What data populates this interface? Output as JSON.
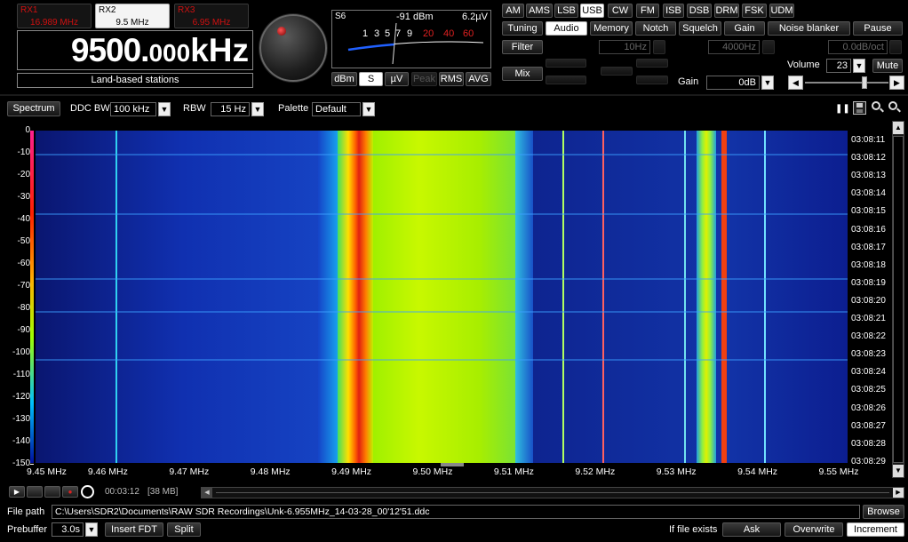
{
  "rx_tabs": [
    {
      "name": "RX1",
      "freq": "16.989 MHz",
      "active": false
    },
    {
      "name": "RX2",
      "freq": "9.5 MHz",
      "active": true
    },
    {
      "name": "RX3",
      "freq": "6.95 MHz",
      "active": false
    }
  ],
  "frequency_display": {
    "value": "9500.",
    "small": "000",
    "unit": "kHz"
  },
  "station_label": "Land-based stations",
  "smeter": {
    "s_label": "S6",
    "dbm": "-91 dBm",
    "uv": "6.2µV",
    "scale_white": [
      "1",
      "3",
      "5",
      "7",
      "9"
    ],
    "scale_red": [
      "20",
      "40",
      "60"
    ]
  },
  "meter_buttons": [
    {
      "label": "dBm",
      "on": false
    },
    {
      "label": "S",
      "on": true
    },
    {
      "label": "µV",
      "on": false
    },
    {
      "label": "Peak",
      "dim": true
    },
    {
      "label": "RMS",
      "on": false
    },
    {
      "label": "AVG",
      "on": false
    }
  ],
  "modes": [
    {
      "label": "AM"
    },
    {
      "label": "AMS"
    },
    {
      "label": "LSB"
    },
    {
      "label": "USB",
      "on": true
    },
    {
      "label": "CW"
    },
    {
      "label": "FM"
    },
    {
      "label": "ISB"
    },
    {
      "label": "DSB"
    },
    {
      "label": "DRM"
    },
    {
      "label": "FSK"
    },
    {
      "label": "UDM"
    }
  ],
  "tabs": [
    {
      "label": "Tuning"
    },
    {
      "label": "Audio",
      "on": true
    },
    {
      "label": "Memory"
    },
    {
      "label": "Notch"
    },
    {
      "label": "Squelch"
    },
    {
      "label": "Gain"
    },
    {
      "label": "Noise blanker"
    },
    {
      "label": "Pause"
    }
  ],
  "audio": {
    "filter_label": "Filter",
    "mix_label": "Mix",
    "low_cut": "10Hz",
    "high_cut": "4000Hz",
    "slope": "0.0dB/oct",
    "volume_label": "Volume",
    "volume": "23",
    "mute_label": "Mute",
    "gain_label": "Gain",
    "gain": "0dB",
    "volume_level": 0.9
  },
  "toolbar": {
    "spectrum_label": "Spectrum",
    "ddc_label": "DDC BW",
    "ddc_value": "100 kHz",
    "rbw_label": "RBW",
    "rbw_value": "15 Hz",
    "palette_label": "Palette",
    "palette_value": "Default"
  },
  "y_axis": [
    "0",
    "-10",
    "-20",
    "-30",
    "-40",
    "-50",
    "-60",
    "-70",
    "-80",
    "-90",
    "-100",
    "-110",
    "-120",
    "-130",
    "-140",
    "-150"
  ],
  "timestamps": [
    "03:08:11",
    "03:08:12",
    "03:08:13",
    "03:08:14",
    "03:08:15",
    "03:08:16",
    "03:08:17",
    "03:08:18",
    "03:08:19",
    "03:08:20",
    "03:08:21",
    "03:08:22",
    "03:08:23",
    "03:08:24",
    "03:08:25",
    "03:08:26",
    "03:08:27",
    "03:08:28",
    "03:08:29"
  ],
  "x_axis": [
    "9.45 MHz",
    "9.46 MHz",
    "9.47 MHz",
    "9.48 MHz",
    "9.49 MHz",
    "9.50 MHz",
    "9.51 MHz",
    "9.52 MHz",
    "9.53 MHz",
    "9.54 MHz",
    "9.55 MHz"
  ],
  "playback": {
    "time": "00:03:12",
    "size": "[38 MB]"
  },
  "file": {
    "label": "File path",
    "path": "C:\\Users\\SDR2\\Documents\\RAW SDR Recordings\\Unk-6.955MHz_14-03-28_00'12'51.ddc",
    "browse": "Browse"
  },
  "bottom": {
    "prebuffer_label": "Prebuffer",
    "prebuffer": "3.0s",
    "insert_fdt": "Insert FDT",
    "split": "Split",
    "if_exists": "If file exists",
    "ask": "Ask",
    "overwrite": "Overwrite",
    "increment": "Increment"
  },
  "colors": {
    "freq_red": "#d01010",
    "waterfall_bg": "#0a1a8c",
    "signal_green": "#a8f000",
    "signal_red": "#e02010"
  }
}
